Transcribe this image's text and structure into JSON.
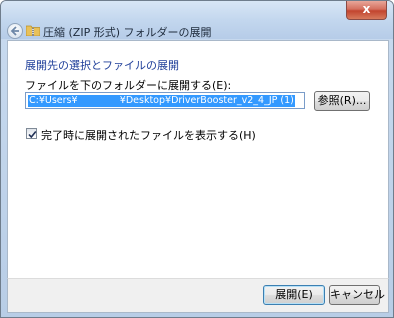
{
  "window": {
    "title": "圧縮 (ZIP 形式) フォルダーの展開",
    "close_label": "x"
  },
  "main": {
    "heading": "展開先の選択とファイルの展開",
    "field_label": "ファイルを下のフォルダーに展開する(E):",
    "path_value": "C:¥Users¥              ¥Desktop¥DriverBooster_v2_4_JP (1)",
    "browse_label": "参照(R)...",
    "show_files_label": "完了時に展開されたファイルを表示する(H)",
    "show_files_checked": true
  },
  "footer": {
    "extract_label": "展開(E)",
    "cancel_label": "キャンセル"
  },
  "icons": {
    "back": "back-arrow-icon",
    "folder": "zip-folder-icon",
    "checkmark": "checkmark-icon"
  },
  "colors": {
    "heading": "#1f3f9a",
    "selection": "#3399ff",
    "close_button": "#c2452f"
  }
}
